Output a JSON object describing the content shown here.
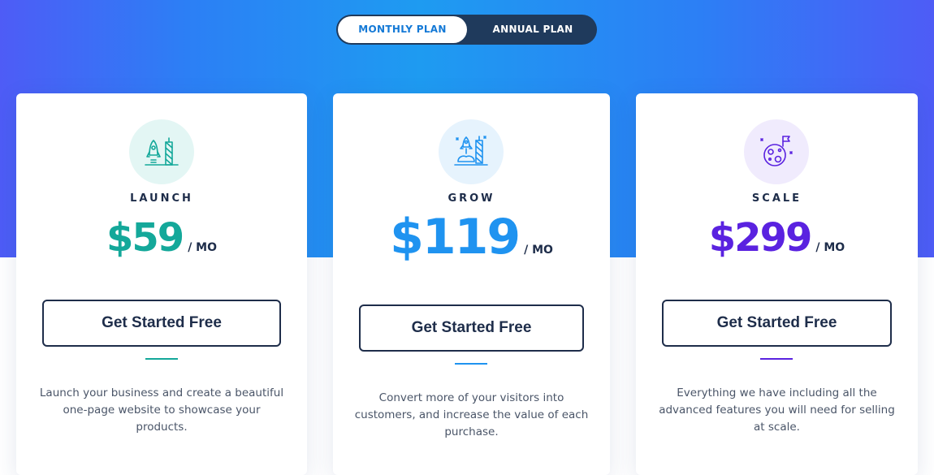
{
  "toggle": {
    "monthly_label": "MONTHLY PLAN",
    "annual_label": "ANNUAL PLAN",
    "active": "monthly"
  },
  "plans": [
    {
      "name": "LAUNCH",
      "price": "$59",
      "period": "/ MO",
      "cta": "Get Started Free",
      "description": "Launch your business and create a beautiful one-page website to showcase your products.",
      "accent": "#14a89a",
      "icon": "rocket-launch-icon"
    },
    {
      "name": "GROW",
      "price": "$119",
      "period": "/ MO",
      "cta": "Get Started Free",
      "description": "Convert more of your visitors into customers, and increase the value of each purchase.",
      "accent": "#1f93f0",
      "icon": "rocket-grow-icon"
    },
    {
      "name": "SCALE",
      "price": "$299",
      "period": "/ MO",
      "cta": "Get Started Free",
      "description": "Everything we have including all the advanced features you will need for selling at scale.",
      "accent": "#5a22e0",
      "icon": "moon-flag-icon"
    }
  ],
  "colors": {
    "hero_gradient": [
      "#4e5cf6",
      "#1e9bf1"
    ],
    "text_dark": "#1e2d4a"
  }
}
